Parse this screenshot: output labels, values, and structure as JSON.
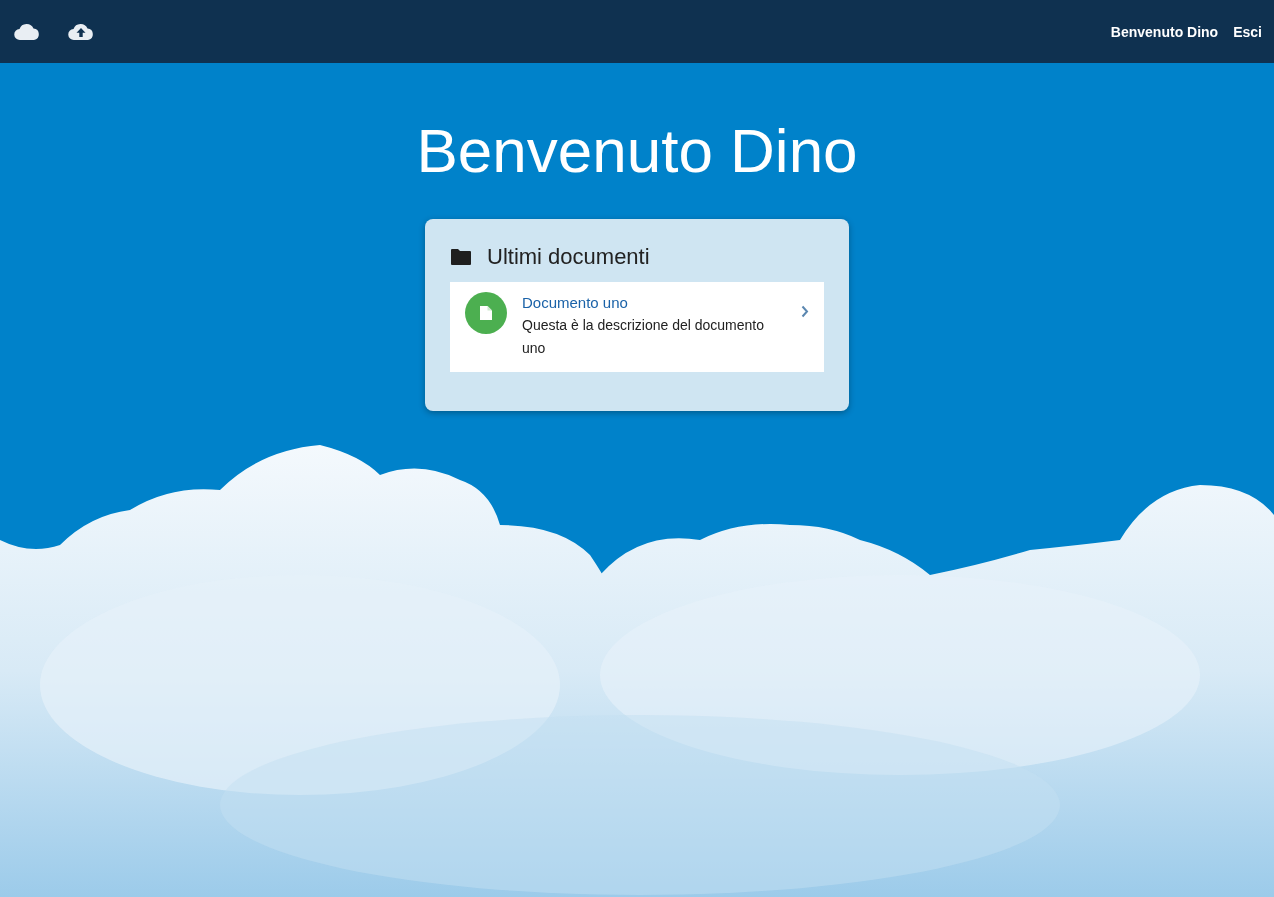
{
  "navbar": {
    "user_greeting": "Benvenuto Dino",
    "logout": "Esci"
  },
  "title": "Benvenuto Dino",
  "recent_documents": {
    "heading": "Ultimi documenti",
    "items": [
      {
        "title": "Documento uno",
        "description": "Questa è la descrizione del documento uno"
      }
    ]
  }
}
